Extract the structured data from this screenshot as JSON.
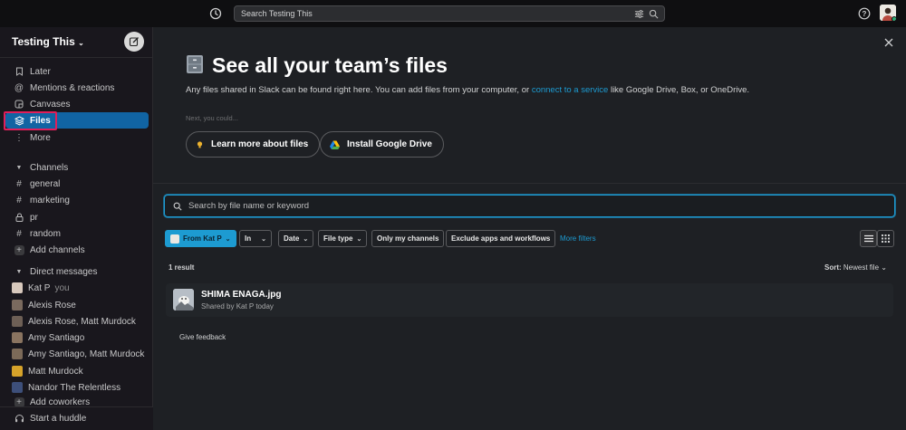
{
  "topbar": {
    "search_text": "Search Testing This"
  },
  "sidebar": {
    "workspace_name": "Testing This",
    "nav": [
      {
        "label": "Later",
        "icon": "bookmark-icon"
      },
      {
        "label": "Mentions & reactions",
        "icon": "at-icon"
      },
      {
        "label": "Canvases",
        "icon": "canvas-icon"
      },
      {
        "label": "Files",
        "icon": "layers-icon",
        "active": true
      },
      {
        "label": "More",
        "icon": "more-vertical-icon"
      }
    ],
    "channels_header": "Channels",
    "channels": [
      "general",
      "marketing",
      "pr",
      "random"
    ],
    "private_channel": "pr",
    "add_channels": "Add channels",
    "dm_header": "Direct messages",
    "dms": [
      {
        "label": "Kat P",
        "suffix": "you",
        "color": "#d8c9bd"
      },
      {
        "label": "Alexis Rose",
        "color": "#7a6a5e"
      },
      {
        "label": "Alexis Rose, Matt Murdock",
        "color": "#6d5f55"
      },
      {
        "label": "Amy Santiago",
        "color": "#8a7460"
      },
      {
        "label": "Amy Santiago, Matt Murdock",
        "color": "#7c6a58"
      },
      {
        "label": "Matt Murdock",
        "color": "#d6a32a"
      },
      {
        "label": "Nandor The Relentless",
        "color": "#3d4f7a"
      }
    ],
    "add_coworkers": "Add coworkers",
    "huddle": "Start a huddle"
  },
  "main": {
    "hero_title": "See all your team’s files",
    "hero_sub_before": "Any files shared in Slack can be found right here. You can add files from your computer, or ",
    "hero_sub_link": "connect to a service",
    "hero_sub_after": " like Google Drive, Box, or OneDrive.",
    "next_label": "Next, you could...",
    "learn_more": "Learn more about files",
    "install_drive": "Install Google Drive",
    "search_placeholder": "Search by file name or keyword",
    "filters": {
      "from": "From Kat P",
      "in": "In",
      "date": "Date",
      "file_type": "File type",
      "only_my_channels": "Only my channels",
      "exclude": "Exclude apps and workflows",
      "more_filters": "More filters"
    },
    "result_count": "1 result",
    "sort_label": "Sort:",
    "sort_value": "Newest file",
    "files": [
      {
        "name": "SHIMA ENAGA.jpg",
        "meta": "Shared by Kat P today"
      }
    ],
    "feedback": "Give feedback"
  },
  "colors": {
    "accent": "#1d9bd1",
    "active_nav": "#1164a3",
    "highlight": "#e01e5a"
  }
}
